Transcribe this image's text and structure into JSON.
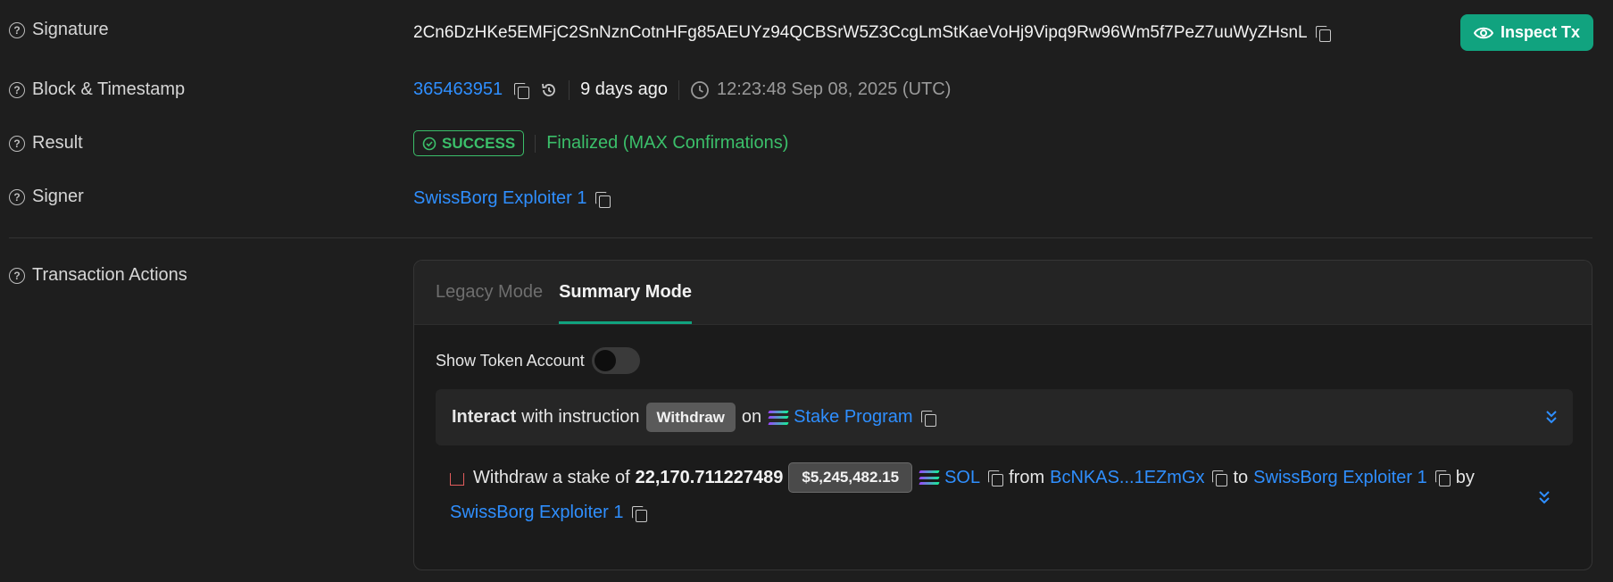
{
  "signature": {
    "label": "Signature",
    "value": "2Cn6DzHKe5EMFjC2SnNznCotnHFg85AEUYz94QCBSrW5Z3CcgLmStKaeVoHj9Vipq9Rw96Wm5f7PeZ7uuWyZHsnL",
    "inspect_label": "Inspect Tx"
  },
  "block": {
    "label": "Block & Timestamp",
    "number": "365463951",
    "age": "9 days ago",
    "timestamp": "12:23:48 Sep 08, 2025 (UTC)"
  },
  "result": {
    "label": "Result",
    "status": "SUCCESS",
    "finality": "Finalized (MAX Confirmations)"
  },
  "signer": {
    "label": "Signer",
    "value": "SwissBorg Exploiter 1"
  },
  "actions": {
    "label": "Transaction Actions",
    "tabs": [
      "Legacy Mode",
      "Summary Mode"
    ],
    "active_tab": "Summary Mode",
    "toggle_label": "Show Token Account",
    "instruction": {
      "lead": "Interact",
      "middle": "with instruction",
      "name": "Withdraw",
      "on": "on",
      "program": "Stake Program"
    },
    "withdraw": {
      "prefix": "Withdraw a stake of",
      "amount": "22,170.711227489",
      "usd": "$5,245,482.15",
      "token": "SOL",
      "from_word": "from",
      "from": "BcNKAS...1EZmGx",
      "to_word": "to",
      "to": "SwissBorg Exploiter 1",
      "by_word": "by",
      "by": "SwissBorg Exploiter 1"
    }
  },
  "colors": {
    "accent": "#11a37f",
    "link": "#2f8fff",
    "success": "#3bbf6a"
  }
}
